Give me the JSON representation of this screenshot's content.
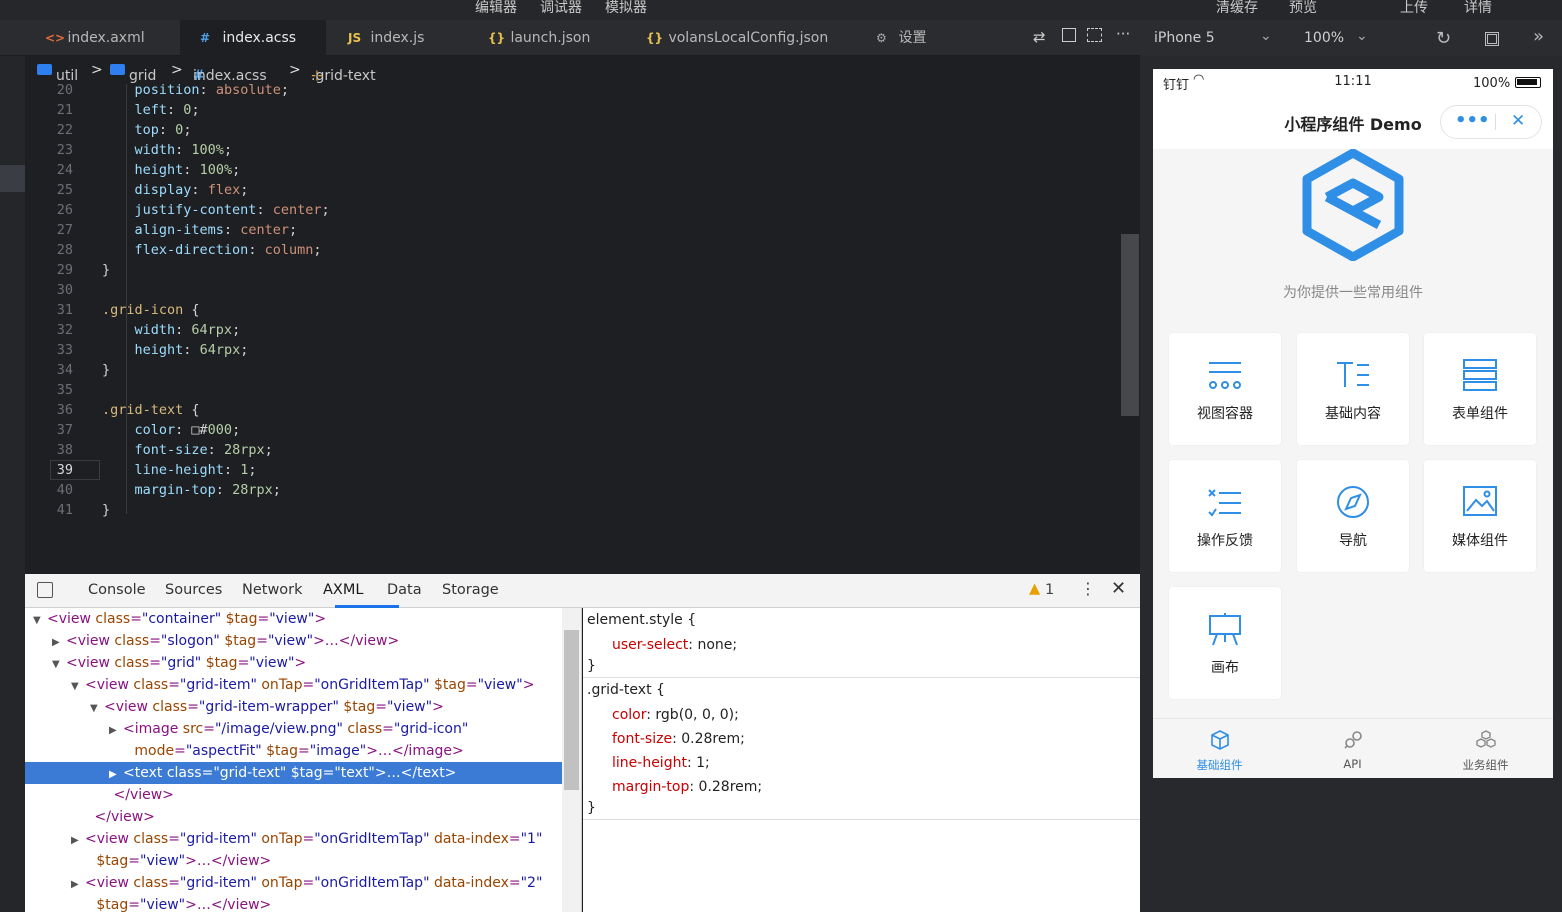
{
  "menu": {
    "editor": "编辑器",
    "debugger": "调试器",
    "simulator": "模拟器",
    "clear_cache": "清缓存",
    "preview": "预览",
    "upload": "上传",
    "details": "详情"
  },
  "tabs": [
    {
      "icon": "<>",
      "label": "index.axml"
    },
    {
      "icon": "#",
      "label": "index.acss"
    },
    {
      "icon": "JS",
      "label": "index.js"
    },
    {
      "icon": "{}",
      "label": "launch.json"
    },
    {
      "icon": "{}",
      "label": "volansLocalConfig.json"
    },
    {
      "icon": "⚙",
      "label": "设置"
    }
  ],
  "device": {
    "name": "iPhone 5",
    "zoom": "100%"
  },
  "breadcrumb": {
    "a": "util",
    "b": "grid",
    "c": "index.acss",
    "d": ".grid-text"
  },
  "code_lines": [
    {
      "n": "20",
      "t": "    position: absolute;"
    },
    {
      "n": "21",
      "t": "    left: 0;"
    },
    {
      "n": "22",
      "t": "    top: 0;"
    },
    {
      "n": "23",
      "t": "    width: 100%;"
    },
    {
      "n": "24",
      "t": "    height: 100%;"
    },
    {
      "n": "25",
      "t": "    display: flex;"
    },
    {
      "n": "26",
      "t": "    justify-content: center;"
    },
    {
      "n": "27",
      "t": "    align-items: center;"
    },
    {
      "n": "28",
      "t": "    flex-direction: column;"
    },
    {
      "n": "29",
      "t": "}"
    },
    {
      "n": "30",
      "t": ""
    },
    {
      "n": "31",
      "t": ".grid-icon {"
    },
    {
      "n": "32",
      "t": "    width: 64rpx;"
    },
    {
      "n": "33",
      "t": "    height: 64rpx;"
    },
    {
      "n": "34",
      "t": "}"
    },
    {
      "n": "35",
      "t": ""
    },
    {
      "n": "36",
      "t": ".grid-text {"
    },
    {
      "n": "37",
      "t": "    color: □#000;"
    },
    {
      "n": "38",
      "t": "    font-size: 28rpx;"
    },
    {
      "n": "39",
      "t": "    line-height: 1;"
    },
    {
      "n": "40",
      "t": "    margin-top: 28rpx;"
    },
    {
      "n": "41",
      "t": "}"
    }
  ],
  "devtools_tabs": [
    "Console",
    "Sources",
    "Network",
    "AXML",
    "Data",
    "Storage"
  ],
  "warning_count": "1",
  "dom_lines": [
    {
      "indent": 0,
      "tri": "▼",
      "html": "<view class=\"container\" $tag=\"view\">"
    },
    {
      "indent": 1,
      "tri": "▶",
      "html": "<view class=\"slogon\" $tag=\"view\">…</view>"
    },
    {
      "indent": 1,
      "tri": "▼",
      "html": "<view class=\"grid\" $tag=\"view\">"
    },
    {
      "indent": 2,
      "tri": "▼",
      "html": "<view class=\"grid-item\" onTap=\"onGridItemTap\" $tag=\"view\">"
    },
    {
      "indent": 3,
      "tri": "▼",
      "html": "<view class=\"grid-item-wrapper\" $tag=\"view\">"
    },
    {
      "indent": 4,
      "tri": "▶",
      "html": "<image src=\"/image/view.png\" class=\"grid-icon\""
    },
    {
      "indent": 4.6,
      "tri": "",
      "html": "mode=\"aspectFit\" $tag=\"image\">…</image>"
    },
    {
      "indent": 4,
      "tri": "▶",
      "html": "<text class=\"grid-text\" $tag=\"text\">…</text>",
      "hl": true
    },
    {
      "indent": 3.5,
      "tri": "",
      "html": "</view>"
    },
    {
      "indent": 2.5,
      "tri": "",
      "html": "</view>"
    },
    {
      "indent": 2,
      "tri": "▶",
      "html": "<view class=\"grid-item\" onTap=\"onGridItemTap\" data-index=\"1\""
    },
    {
      "indent": 2.6,
      "tri": "",
      "html": "$tag=\"view\">…</view>"
    },
    {
      "indent": 2,
      "tri": "▶",
      "html": "<view class=\"grid-item\" onTap=\"onGridItemTap\" data-index=\"2\""
    },
    {
      "indent": 2.6,
      "tri": "",
      "html": "$tag=\"view\">…</view>"
    }
  ],
  "styles": {
    "element_style": "element.style {",
    "user_select_prop": "user-select",
    "user_select_val": "none;",
    "rule": ".grid-text {",
    "props": [
      {
        "p": "color",
        "v": "rgb(0, 0, 0);"
      },
      {
        "p": "font-size",
        "v": "0.28rem;"
      },
      {
        "p": "line-height",
        "v": "1;"
      },
      {
        "p": "margin-top",
        "v": "0.28rem;"
      }
    ],
    "close": "}"
  },
  "phone": {
    "carrier": "钉钉",
    "time": "11:11",
    "battery": "100%",
    "title": "小程序组件 Demo",
    "slogan": "为你提供一些常用组件",
    "grid": [
      "视图容器",
      "基础内容",
      "表单组件",
      "操作反馈",
      "导航",
      "媒体组件",
      "画布"
    ],
    "tabbar": [
      "基础组件",
      "API",
      "业务组件"
    ],
    "accent": "#2f8ee5"
  }
}
